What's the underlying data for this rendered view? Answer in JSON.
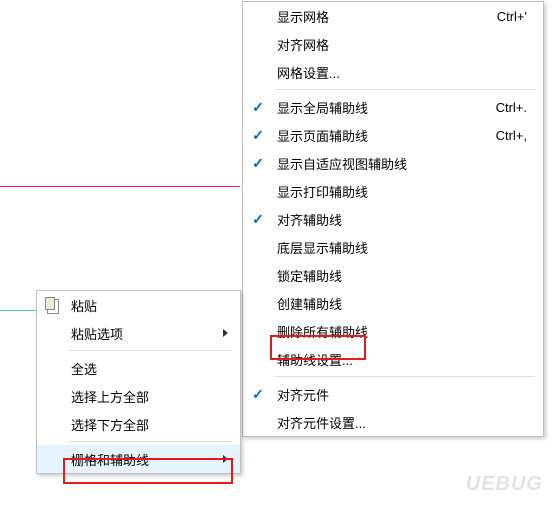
{
  "submenu": {
    "items": [
      {
        "label": "显示网格",
        "shortcut": "Ctrl+'",
        "checked": false
      },
      {
        "label": "对齐网格",
        "shortcut": "",
        "checked": false
      },
      {
        "label": "网格设置...",
        "shortcut": "",
        "checked": false
      },
      {
        "separator": true
      },
      {
        "label": "显示全局辅助线",
        "shortcut": "Ctrl+.",
        "checked": true
      },
      {
        "label": "显示页面辅助线",
        "shortcut": "Ctrl+,",
        "checked": true
      },
      {
        "label": "显示自适应视图辅助线",
        "shortcut": "",
        "checked": true
      },
      {
        "label": "显示打印辅助线",
        "shortcut": "",
        "checked": false
      },
      {
        "label": "对齐辅助线",
        "shortcut": "",
        "checked": true
      },
      {
        "label": "底层显示辅助线",
        "shortcut": "",
        "checked": false
      },
      {
        "label": "锁定辅助线",
        "shortcut": "",
        "checked": false
      },
      {
        "label": "创建辅助线",
        "shortcut": "",
        "checked": false
      },
      {
        "label": "删除所有辅助线",
        "shortcut": "",
        "checked": false
      },
      {
        "label": "辅助线设置...",
        "shortcut": "",
        "checked": false
      },
      {
        "separator": true
      },
      {
        "label": "对齐元件",
        "shortcut": "",
        "checked": true
      },
      {
        "label": "对齐元件设置...",
        "shortcut": "",
        "checked": false
      }
    ]
  },
  "context_menu": {
    "items": [
      {
        "label": "粘贴",
        "icon": "paste",
        "has_submenu": false
      },
      {
        "label": "粘贴选项",
        "has_submenu": true
      },
      {
        "separator": true
      },
      {
        "label": "全选",
        "has_submenu": false
      },
      {
        "label": "选择上方全部",
        "has_submenu": false
      },
      {
        "label": "选择下方全部",
        "has_submenu": false
      },
      {
        "separator": true
      },
      {
        "label": "栅格和辅助线",
        "has_submenu": true,
        "highlighted": true
      }
    ]
  },
  "watermark": "UEBUG"
}
